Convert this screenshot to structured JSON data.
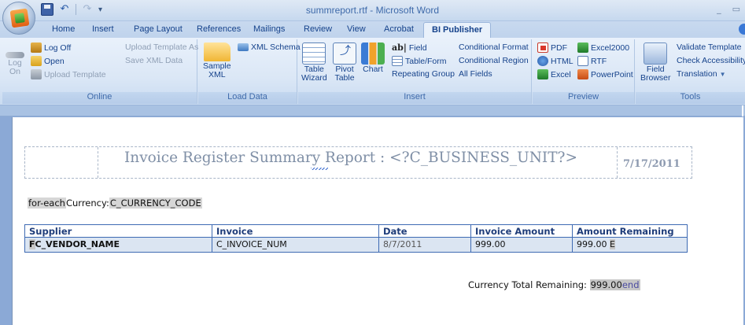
{
  "window": {
    "title": "summreport.rtf - Microsoft Word",
    "controls": [
      "_",
      "▭"
    ]
  },
  "quick_access": {
    "undo": "↶",
    "redo": "↷",
    "more": "▾"
  },
  "tabs": [
    {
      "label": "Home"
    },
    {
      "label": "Insert"
    },
    {
      "label": "Page Layout"
    },
    {
      "label": "References"
    },
    {
      "label": "Mailings"
    },
    {
      "label": "Review"
    },
    {
      "label": "View"
    },
    {
      "label": "Acrobat"
    },
    {
      "label": "BI Publisher"
    }
  ],
  "ribbon": {
    "online": {
      "label": "Online",
      "log_on": "Log\nOn",
      "log_off": "Log Off",
      "open": "Open",
      "upload_template": "Upload Template",
      "upload_template_as": "Upload Template As",
      "save_xml_data": "Save XML Data"
    },
    "load_data": {
      "label": "Load Data",
      "sample_xml": "Sample\nXML",
      "xml_schema": "XML Schema"
    },
    "insert": {
      "label": "Insert",
      "table_wizard": "Table\nWizard",
      "pivot_table": "Pivot\nTable",
      "chart": "Chart",
      "field": "Field",
      "table_form": "Table/Form",
      "repeating_group": "Repeating Group",
      "conditional_format": "Conditional Format",
      "conditional_region": "Conditional Region",
      "all_fields": "All Fields"
    },
    "preview": {
      "label": "Preview",
      "pdf": "PDF",
      "html": "HTML",
      "excel": "Excel",
      "excel2000": "Excel2000",
      "rtf": "RTF",
      "powerpoint": "PowerPoint"
    },
    "tools": {
      "label": "Tools",
      "field_browser": "Field\nBrowser",
      "validate_template": "Validate Template",
      "check_accessibility": "Check Accessibility",
      "translation": "Translation"
    }
  },
  "document": {
    "report_title": "Invoice Register Summary Report : <?C_BUSINESS_UNIT?>",
    "report_date": "7/17/2011",
    "for_each_field": "for-each",
    "currency_label": "Currency: ",
    "currency_field": "C_CURRENCY_CODE",
    "table": {
      "headers": [
        "Supplier",
        "Invoice",
        "Date",
        "Invoice Amount",
        "Amount Remaining"
      ],
      "row": {
        "supplier_prefix": "F",
        "supplier": "C_VENDOR_NAME",
        "invoice": "C_INVOICE_NUM",
        "date": "8/7/2011",
        "invoice_amount": "999.00",
        "amount_remaining": "999.00",
        "end_marker": "E"
      }
    },
    "total_label": "Currency Total Remaining: ",
    "total_value": "999.00",
    "total_end": "end"
  }
}
